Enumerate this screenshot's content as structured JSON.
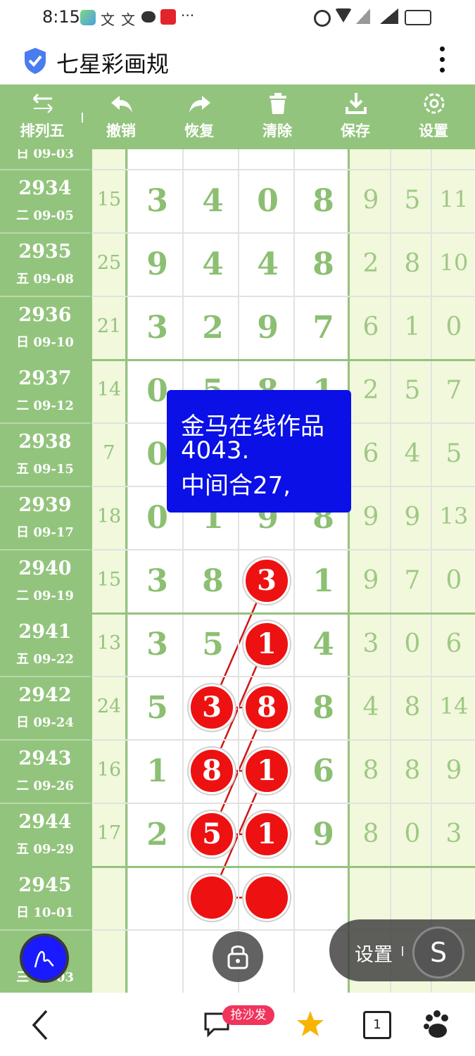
{
  "status_bar": {
    "time": "8:15",
    "more": "···"
  },
  "app_bar": {
    "title": "七星彩画规"
  },
  "toolbar": {
    "items": [
      {
        "label": "排列五",
        "icon": "swap-arrows-icon"
      },
      {
        "label": "撤销",
        "icon": "undo-icon"
      },
      {
        "label": "恢复",
        "icon": "redo-icon"
      },
      {
        "label": "清除",
        "icon": "trash-icon"
      },
      {
        "label": "保存",
        "icon": "download-icon"
      },
      {
        "label": "设置",
        "icon": "gear-icon"
      }
    ]
  },
  "rows": [
    {
      "issue": "2934",
      "date": "二 09-05",
      "sum": "15",
      "digits": [
        "3",
        "4",
        "0",
        "8"
      ],
      "right": [
        "9",
        "5",
        "11"
      ]
    },
    {
      "issue": "2935",
      "date": "五 09-08",
      "sum": "25",
      "digits": [
        "9",
        "4",
        "4",
        "8"
      ],
      "right": [
        "2",
        "8",
        "10"
      ]
    },
    {
      "issue": "2936",
      "date": "日 09-10",
      "sum": "21",
      "digits": [
        "3",
        "2",
        "9",
        "7"
      ],
      "right": [
        "6",
        "1",
        "0"
      ]
    },
    {
      "issue": "2937",
      "date": "二 09-12",
      "sum": "14",
      "digits": [
        "0",
        "5",
        "8",
        "1"
      ],
      "right": [
        "2",
        "5",
        "7"
      ]
    },
    {
      "issue": "2938",
      "date": "五 09-15",
      "sum": "7",
      "digits": [
        "0",
        "",
        "",
        ""
      ],
      "right": [
        "6",
        "4",
        "5"
      ]
    },
    {
      "issue": "2939",
      "date": "日 09-17",
      "sum": "18",
      "digits": [
        "0",
        "1",
        "9",
        "8"
      ],
      "right": [
        "9",
        "9",
        "13"
      ]
    },
    {
      "issue": "2940",
      "date": "二 09-19",
      "sum": "15",
      "digits": [
        "3",
        "8",
        "",
        "1"
      ],
      "right": [
        "9",
        "7",
        "0"
      ]
    },
    {
      "issue": "2941",
      "date": "五 09-22",
      "sum": "13",
      "digits": [
        "3",
        "5",
        "",
        "4"
      ],
      "right": [
        "3",
        "0",
        "6"
      ]
    },
    {
      "issue": "2942",
      "date": "日 09-24",
      "sum": "24",
      "digits": [
        "5",
        "",
        "",
        "8"
      ],
      "right": [
        "4",
        "8",
        "14"
      ]
    },
    {
      "issue": "2943",
      "date": "二 09-26",
      "sum": "16",
      "digits": [
        "1",
        "",
        "",
        "6"
      ],
      "right": [
        "8",
        "8",
        "9"
      ]
    },
    {
      "issue": "2944",
      "date": "五 09-29",
      "sum": "17",
      "digits": [
        "2",
        "",
        "",
        "9"
      ],
      "right": [
        "8",
        "0",
        "3"
      ]
    },
    {
      "issue": "2945",
      "date": "日 10-01",
      "sum": "",
      "digits": [
        "",
        "",
        "",
        ""
      ],
      "right": [
        "",
        "",
        ""
      ]
    }
  ],
  "partial_top_date": "日 09-03",
  "partial_bottom_date": "三 10-03",
  "balls": {
    "col3": [
      "3",
      "1",
      "8",
      "1",
      "1",
      ""
    ],
    "col2": [
      "3",
      "8",
      "5",
      ""
    ]
  },
  "popup": {
    "line1": "金马在线作品",
    "line2": "4043.",
    "line3": "中间合27,"
  },
  "floating": {
    "settings_label": "设置",
    "s_label": "S"
  },
  "bottom_nav": {
    "badge": "抢沙发",
    "tab_count": "1"
  },
  "colors": {
    "header_green": "#93c47d",
    "cell_light": "#f2f8dc",
    "digit_green": "#8cbf72",
    "ball_red": "#ee1111",
    "popup_blue": "#0a10e6"
  }
}
